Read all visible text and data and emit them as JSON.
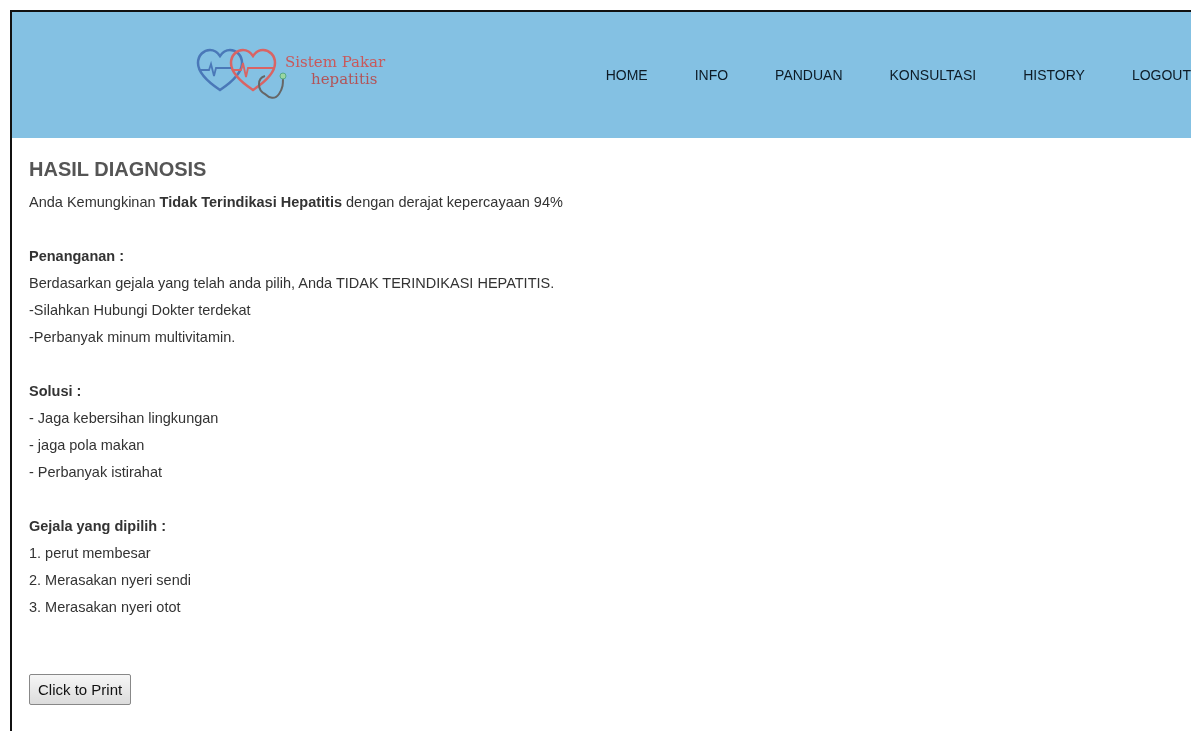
{
  "header": {
    "logo": {
      "line_1": "Sistem Pakar",
      "line_2": "hepatitis"
    },
    "nav": [
      {
        "label": "HOME"
      },
      {
        "label": "INFO"
      },
      {
        "label": "PANDUAN"
      },
      {
        "label": "KONSULTASI"
      },
      {
        "label": "HISTORY"
      },
      {
        "label": "LOGOUT"
      }
    ]
  },
  "title": "HASIL DIAGNOSIS",
  "summary": "Anda Kemungkinan **Tidak Terindikasi Hepatitis** dengan derajat kepercayaan 94%",
  "sections": [
    {
      "heading": "Penanganan :",
      "lines": [
        "Berdasarkan gejala yang telah anda pilih, Anda TIDAK TERINDIKASI HEPATITIS.",
        "-Silahkan Hubungi Dokter terdekat",
        "-Perbanyak minum multivitamin."
      ]
    },
    {
      "heading": "Solusi :",
      "lines": [
        "- Jaga kebersihan lingkungan",
        "- jaga pola makan",
        "- Perbanyak istirahat"
      ]
    },
    {
      "heading": "Gejala yang dipilih :",
      "lines": [
        "1. perut membesar",
        "2. Merasakan nyeri sendi",
        "3. Merasakan nyeri otot"
      ]
    }
  ],
  "print_button": "Click to Print"
}
